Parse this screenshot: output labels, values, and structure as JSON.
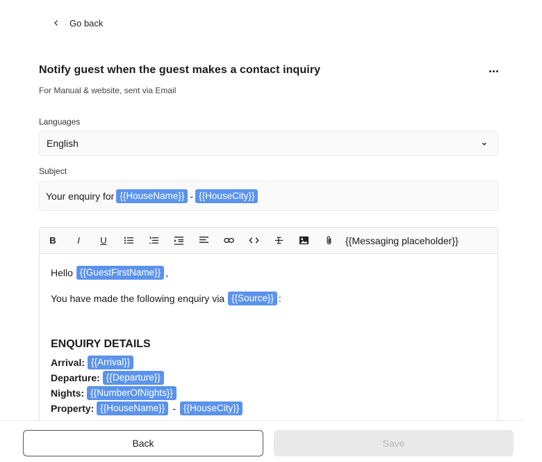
{
  "nav": {
    "back_label": "Go back"
  },
  "header": {
    "title": "Notify guest when the guest makes a contact inquiry",
    "subtitle": "For Manual & website, sent via Email"
  },
  "languages": {
    "label": "Languages",
    "selected": "English"
  },
  "subject": {
    "label": "Subject",
    "prefix": "Your enquiry for",
    "tag1": "{{HouseName}}",
    "separator": "-",
    "tag2": "{{HouseCity}}"
  },
  "toolbar": {
    "placeholder_label": "{{Messaging placeholder}}"
  },
  "editor": {
    "greeting": "Hello",
    "greeting_tag": "{{GuestFirstName}}",
    "greeting_suffix": ",",
    "line2": "You have made the following enquiry via",
    "line2_tag": "{{Source}}",
    "line2_suffix": ":",
    "heading": "ENQUIRY DETAILS",
    "details": {
      "arrival_label": "Arrival:",
      "arrival_tag": "{{Arrival}}",
      "departure_label": "Departure:",
      "departure_tag": "{{Departure}}",
      "nights_label": "Nights:",
      "nights_tag": "{{NumberOfNights}}",
      "property_label": "Property:",
      "property_tag1": "{{HouseName}}",
      "property_sep": "-",
      "property_tag2": "{{HouseCity}}"
    }
  },
  "footer": {
    "back_label": "Back",
    "save_label": "Save"
  }
}
